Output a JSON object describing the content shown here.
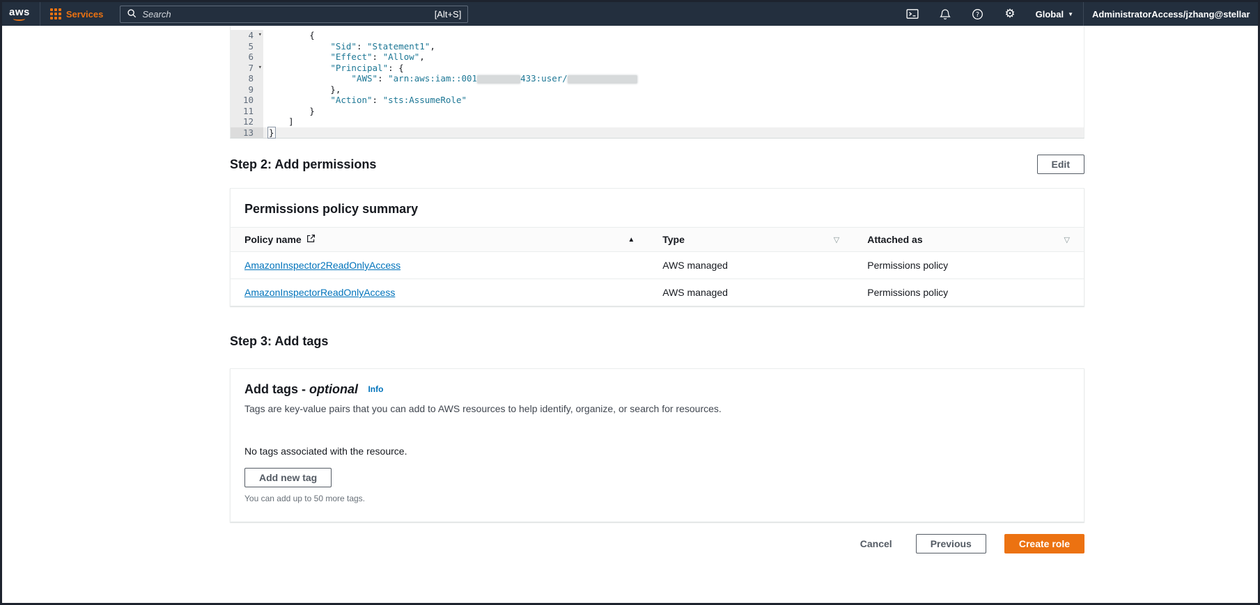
{
  "topnav": {
    "logo": "aws",
    "services_label": "Services",
    "search_placeholder": "Search",
    "search_shortcut": "[Alt+S]",
    "region_label": "Global",
    "account_label": "AdministratorAccess/jzhang@stellar"
  },
  "icons": {
    "gear": "⚙",
    "chevron_down": "▼",
    "fold": "▾",
    "sort_asc": "▲",
    "filter": "▽"
  },
  "editor": {
    "lines": [
      {
        "num": "4",
        "fold": true,
        "tokens": [
          {
            "t": "        {",
            "c": "p"
          }
        ]
      },
      {
        "num": "5",
        "tokens": [
          {
            "t": "            ",
            "c": "p"
          },
          {
            "t": "\"Sid\"",
            "c": "k"
          },
          {
            "t": ": ",
            "c": "p"
          },
          {
            "t": "\"Statement1\"",
            "c": "s"
          },
          {
            "t": ",",
            "c": "p"
          }
        ]
      },
      {
        "num": "6",
        "tokens": [
          {
            "t": "            ",
            "c": "p"
          },
          {
            "t": "\"Effect\"",
            "c": "k"
          },
          {
            "t": ": ",
            "c": "p"
          },
          {
            "t": "\"Allow\"",
            "c": "s"
          },
          {
            "t": ",",
            "c": "p"
          }
        ]
      },
      {
        "num": "7",
        "fold": true,
        "tokens": [
          {
            "t": "            ",
            "c": "p"
          },
          {
            "t": "\"Principal\"",
            "c": "k"
          },
          {
            "t": ": {",
            "c": "p"
          }
        ]
      },
      {
        "num": "8",
        "tokens": [
          {
            "t": "                ",
            "c": "p"
          },
          {
            "t": "\"AWS\"",
            "c": "k"
          },
          {
            "t": ": ",
            "c": "p"
          },
          {
            "t": "\"arn:aws:iam::001",
            "c": "s"
          },
          {
            "c": "r",
            "w": 62
          },
          {
            "t": "433:user/",
            "c": "s"
          },
          {
            "c": "r",
            "w": 100
          }
        ]
      },
      {
        "num": "9",
        "tokens": [
          {
            "t": "            },",
            "c": "p"
          }
        ]
      },
      {
        "num": "10",
        "tokens": [
          {
            "t": "            ",
            "c": "p"
          },
          {
            "t": "\"Action\"",
            "c": "k"
          },
          {
            "t": ": ",
            "c": "p"
          },
          {
            "t": "\"sts:AssumeRole\"",
            "c": "s"
          }
        ]
      },
      {
        "num": "11",
        "tokens": [
          {
            "t": "        }",
            "c": "p"
          }
        ]
      },
      {
        "num": "12",
        "tokens": [
          {
            "t": "    ]",
            "c": "p"
          }
        ]
      },
      {
        "num": "13",
        "active": true,
        "tokens": [
          {
            "t": "}",
            "c": "b"
          }
        ]
      }
    ]
  },
  "step2": {
    "title": "Step 2: Add permissions",
    "edit_label": "Edit"
  },
  "permissions": {
    "panel_title": "Permissions policy summary",
    "columns": [
      "Policy name",
      "Type",
      "Attached as"
    ],
    "rows": [
      {
        "name": "AmazonInspector2ReadOnlyAccess",
        "type": "AWS managed",
        "attached": "Permissions policy"
      },
      {
        "name": "AmazonInspectorReadOnlyAccess",
        "type": "AWS managed",
        "attached": "Permissions policy"
      }
    ]
  },
  "step3": {
    "title": "Step 3: Add tags"
  },
  "tags": {
    "title": "Add tags - ",
    "title_optional": "optional",
    "info_label": "Info",
    "description": "Tags are key-value pairs that you can add to AWS resources to help identify, organize, or search for resources.",
    "empty_text": "No tags associated with the resource.",
    "add_button": "Add new tag",
    "limit_text": "You can add up to 50 more tags."
  },
  "footer": {
    "cancel": "Cancel",
    "previous": "Previous",
    "create": "Create role"
  },
  "colors": {
    "accent": "#ec7211",
    "link": "#0073bb",
    "nav": "#232f3e"
  }
}
